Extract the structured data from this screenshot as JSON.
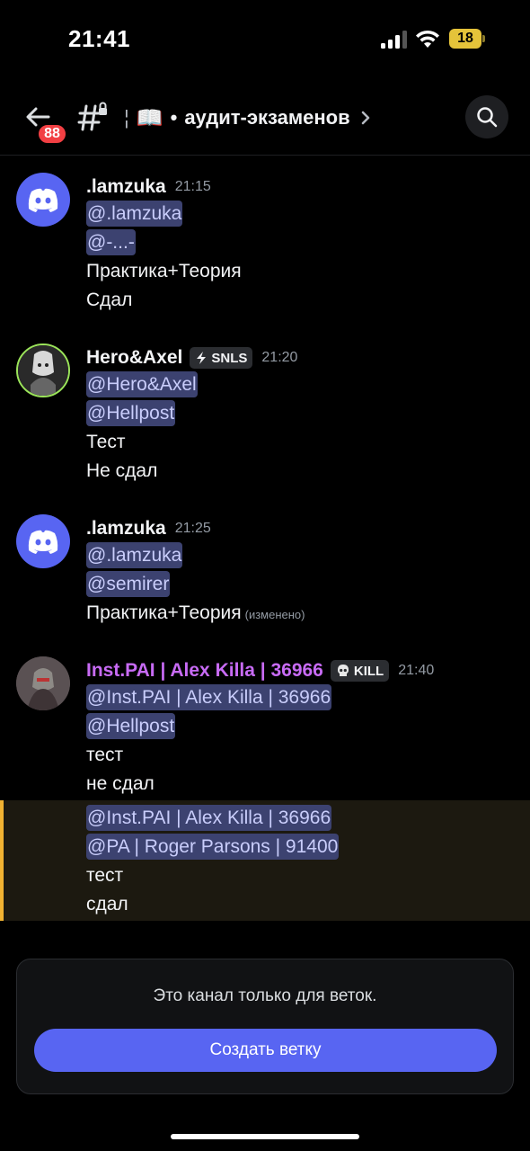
{
  "status_bar": {
    "time": "21:41",
    "battery": "18"
  },
  "header": {
    "back_badge": "88",
    "channel_emoji": "📖",
    "channel_sep": "¦",
    "channel_dot": "•",
    "channel_name": "аудит-экзаменов"
  },
  "messages": [
    {
      "author": ".lamzuka",
      "time": "21:15",
      "mentions": [
        "@.lamzuka",
        "@-...-"
      ],
      "lines": [
        "Практика+Теория",
        "Сдал"
      ]
    },
    {
      "author": "Hero&Axel",
      "tag": "SNLS",
      "time": "21:20",
      "mentions": [
        "@Hero&Axel",
        "@Hellpost"
      ],
      "lines": [
        "Тест",
        "Не сдал"
      ]
    },
    {
      "author": ".lamzuka",
      "time": "21:25",
      "mentions": [
        "@.lamzuka",
        "@semirer"
      ],
      "lines": [
        "Практика+Теория"
      ],
      "edited": "(изменено)"
    },
    {
      "author": "Inst.PAI | Alex Killa | 36966",
      "tag": "KILL",
      "time": "21:40",
      "mentions": [
        "@Inst.PAI | Alex Killa | 36966",
        "@Hellpost"
      ],
      "lines": [
        "тест",
        "не сдал"
      ]
    }
  ],
  "continuation": {
    "mentions": [
      "@Inst.PAI | Alex Killa | 36966",
      "@PA | Roger Parsons | 91400"
    ],
    "lines": [
      "тест",
      "сдал"
    ]
  },
  "thread_only": {
    "text": "Это канал только для веток.",
    "button": "Создать ветку"
  },
  "colors": {
    "accent": "#5865f2",
    "mention_bg": "#3c4270",
    "highlight_bar": "#f0b232",
    "badge_red": "#f23f43",
    "author_purple": "#c86bf5"
  },
  "icons": [
    "back-arrow-icon",
    "thread-lock-icon",
    "chevron-right-icon",
    "search-icon",
    "discord-logo-icon",
    "lightning-icon",
    "skull-icon",
    "wifi-icon",
    "signal-icon",
    "battery-icon"
  ]
}
